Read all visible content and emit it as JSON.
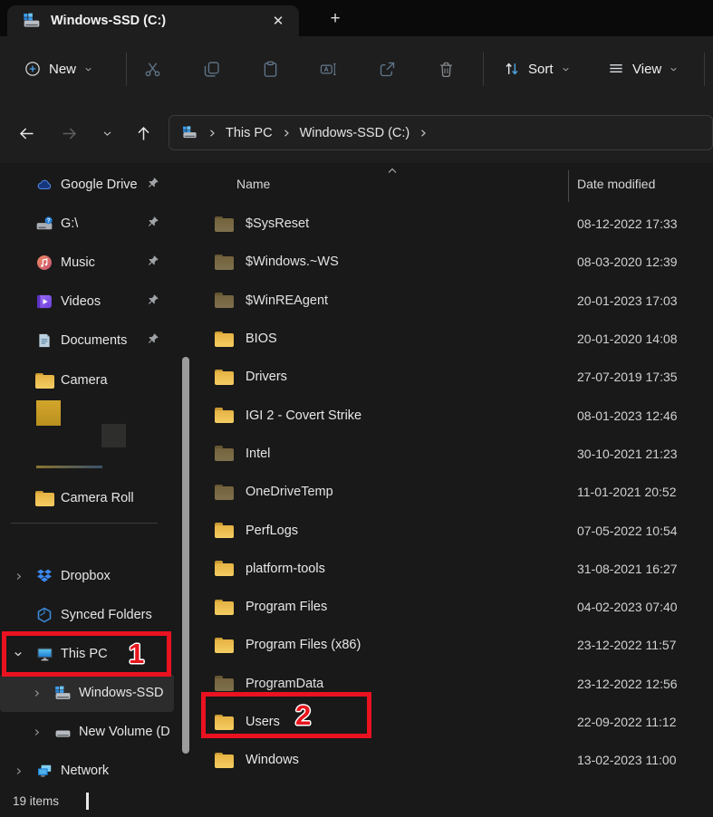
{
  "window": {
    "tab_title": "Windows-SSD (C:)",
    "close_glyph": "✕",
    "newtab_glyph": "+",
    "status_items": "19 items"
  },
  "toolbar": {
    "new": {
      "label": "New"
    },
    "icon_buttons": [
      "cut-icon",
      "copy-icon",
      "paste-icon",
      "rename-icon",
      "share-icon",
      "delete-icon"
    ],
    "sort": {
      "label": "Sort"
    },
    "view": {
      "label": "View"
    }
  },
  "navigation": {
    "breadcrumb": {
      "items": [
        "This PC",
        "Windows-SSD (C:)"
      ]
    }
  },
  "list_columns": {
    "name": "Name",
    "date_modified": "Date modified"
  },
  "sidebar": {
    "items": [
      {
        "label": "Google Drive",
        "icon": "google-drive-icon",
        "pinned": true
      },
      {
        "label": "G:\\",
        "icon": "drive-unknown-icon",
        "pinned": true
      },
      {
        "label": "Music",
        "icon": "music-icon",
        "pinned": true
      },
      {
        "label": "Videos",
        "icon": "videos-icon",
        "pinned": true
      },
      {
        "label": "Documents",
        "icon": "documents-icon",
        "pinned": true
      },
      {
        "label": "Camera",
        "icon": "folder-icon"
      },
      {
        "label": "Camera Roll",
        "icon": "folder-icon"
      },
      {
        "label": "Dropbox",
        "icon": "dropbox-icon",
        "expander": "collapsed"
      },
      {
        "label": "Synced Folders",
        "icon": "synced-folders-icon"
      },
      {
        "label": "This PC",
        "icon": "this-pc-icon",
        "expander": "expanded"
      },
      {
        "label": "Windows-SSD",
        "icon": "drive-windows-icon",
        "expander": "collapsed",
        "selected": true
      },
      {
        "label": "New Volume (D",
        "icon": "drive-icon",
        "expander": "collapsed"
      },
      {
        "label": "Network",
        "icon": "network-icon",
        "expander": "collapsed"
      }
    ]
  },
  "files": [
    {
      "name": "$SysReset",
      "date_modified": "08-12-2022 17:33",
      "dim": true
    },
    {
      "name": "$Windows.~WS",
      "date_modified": "08-03-2020 12:39",
      "dim": true
    },
    {
      "name": "$WinREAgent",
      "date_modified": "20-01-2023 17:03",
      "dim": true
    },
    {
      "name": "BIOS",
      "date_modified": "20-01-2020 14:08",
      "dim": false
    },
    {
      "name": "Drivers",
      "date_modified": "27-07-2019 17:35",
      "dim": false
    },
    {
      "name": "IGI 2 - Covert Strike",
      "date_modified": "08-01-2023 12:46",
      "dim": false
    },
    {
      "name": "Intel",
      "date_modified": "30-10-2021 21:23",
      "dim": true
    },
    {
      "name": "OneDriveTemp",
      "date_modified": "11-01-2021 20:52",
      "dim": true
    },
    {
      "name": "PerfLogs",
      "date_modified": "07-05-2022 10:54",
      "dim": false
    },
    {
      "name": "platform-tools",
      "date_modified": "31-08-2021 16:27",
      "dim": false
    },
    {
      "name": "Program Files",
      "date_modified": "04-02-2023 07:40",
      "dim": false
    },
    {
      "name": "Program Files (x86)",
      "date_modified": "23-12-2022 11:57",
      "dim": false
    },
    {
      "name": "ProgramData",
      "date_modified": "23-12-2022 12:56",
      "dim": true
    },
    {
      "name": "Users",
      "date_modified": "22-09-2022 11:12",
      "dim": false
    },
    {
      "name": "Windows",
      "date_modified": "13-02-2023 11:00",
      "dim": false
    }
  ],
  "annotations": {
    "step_1": "1",
    "step_2": "2",
    "highlight_color": "#ea1220"
  },
  "colors": {
    "window_bg": "#191919",
    "chrome_bg": "#1e1e1e",
    "titlebar_bg": "#0a0a0a",
    "accent_blue": "#4da3e0",
    "folder_yellow": "#f4cd63",
    "selection": "#2c2c2c"
  }
}
